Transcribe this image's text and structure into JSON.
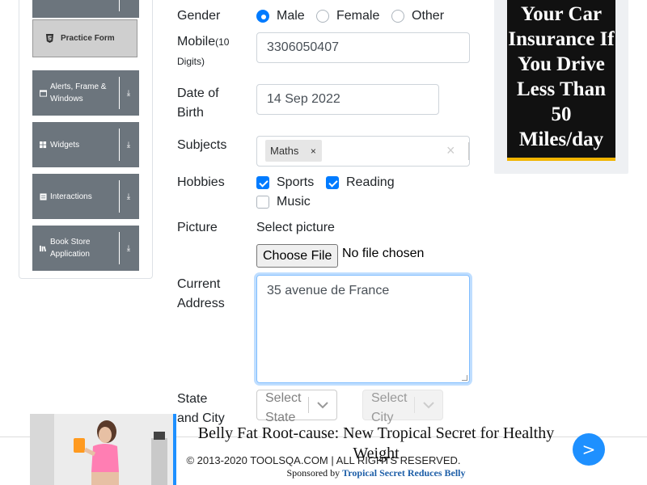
{
  "sidebar": {
    "active_item": "Practice Form",
    "groups": [
      {
        "label": "Alerts, Frame & Windows",
        "icon": "window-icon"
      },
      {
        "label": "Widgets",
        "icon": "widgets-icon"
      },
      {
        "label": "Interactions",
        "icon": "interactions-icon"
      },
      {
        "label": "Book Store Application",
        "icon": "bookstore-icon"
      }
    ]
  },
  "form": {
    "gender": {
      "label": "Gender",
      "options": [
        "Male",
        "Female",
        "Other"
      ],
      "selected": "Male"
    },
    "mobile": {
      "label": "Mobile",
      "hint": "(10 Digits)",
      "value": "3306050407"
    },
    "dob": {
      "label": "Date of Birth",
      "value": "14 Sep 2022"
    },
    "subjects": {
      "label": "Subjects",
      "chips": [
        "Maths"
      ],
      "clear": "×",
      "remove": "×"
    },
    "hobbies": {
      "label": "Hobbies",
      "options": [
        {
          "label": "Sports",
          "checked": true
        },
        {
          "label": "Reading",
          "checked": true
        },
        {
          "label": "Music",
          "checked": false
        }
      ]
    },
    "picture": {
      "label": "Picture",
      "select_label": "Select picture",
      "button": "Choose File",
      "status": "No file chosen"
    },
    "address": {
      "label": "Current Address",
      "value": "35 avenue de France"
    },
    "state_city": {
      "label": "State and City",
      "state_placeholder": "Select State",
      "city_placeholder": "Select City"
    }
  },
  "ads": {
    "right": {
      "text": "Your Car Insurance If You Drive Less Than 50 Miles/day"
    },
    "bottom": {
      "title": "Belly Fat Root-cause: New Tropical Secret for Healthy Weight",
      "sponsor_prefix": "Sponsored by",
      "sponsor_name": "Tropical Secret Reduces Belly",
      "next": ">"
    }
  },
  "footer": {
    "text": "© 2013-2020 TOOLSQA.COM | ALL RIGHTS RESERVED."
  },
  "colors": {
    "primary": "#007bff",
    "sidebar": "#6c757d",
    "ad_accent": "#1e90ff"
  }
}
